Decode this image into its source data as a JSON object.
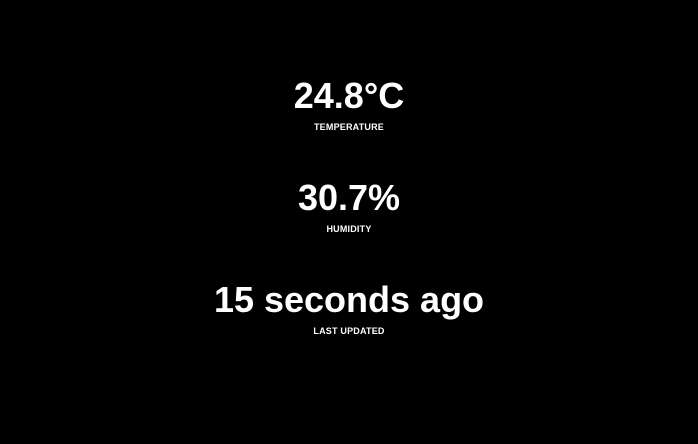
{
  "readings": {
    "temperature": {
      "value": "24.8°C",
      "label": "TEMPERATURE"
    },
    "humidity": {
      "value": "30.7%",
      "label": "HUMIDITY"
    },
    "last_updated": {
      "value": "15 seconds ago",
      "label": "LAST UPDATED"
    }
  },
  "colors": {
    "background": "#000000",
    "text": "#ffffff"
  }
}
